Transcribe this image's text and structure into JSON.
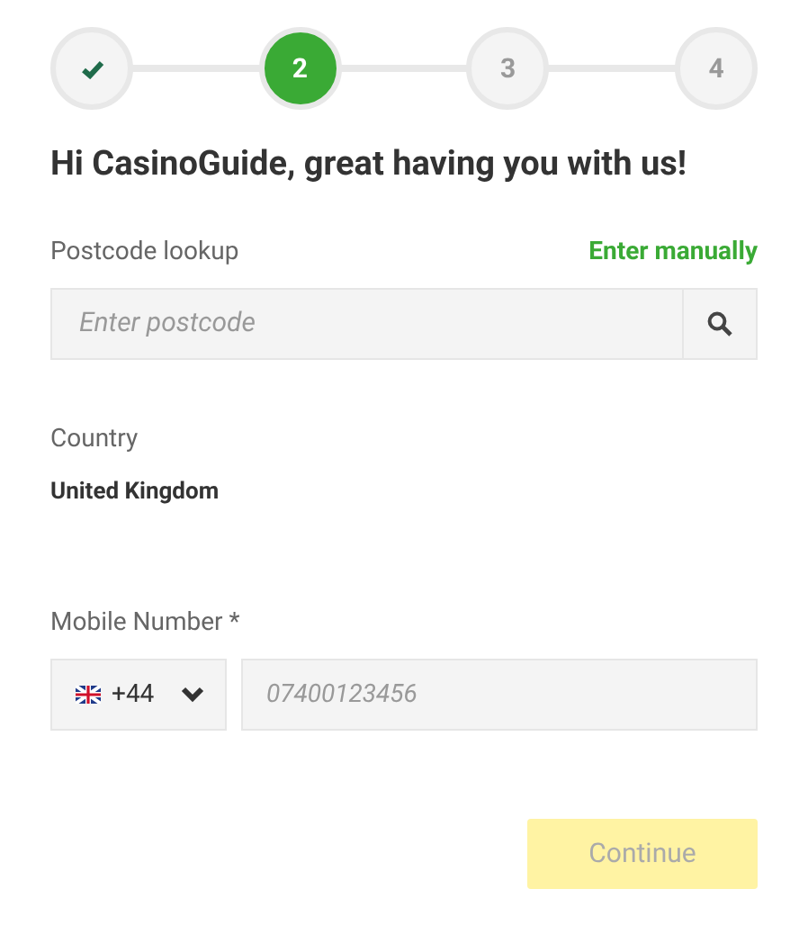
{
  "steps": [
    {
      "kind": "done"
    },
    {
      "kind": "current",
      "label": "2"
    },
    {
      "kind": "upcoming",
      "label": "3"
    },
    {
      "kind": "upcoming",
      "label": "4"
    }
  ],
  "heading": "Hi CasinoGuide, great having you with us!",
  "postcode": {
    "label": "Postcode lookup",
    "link": "Enter manually",
    "placeholder": "Enter postcode"
  },
  "country": {
    "label": "Country",
    "value": "United Kingdom"
  },
  "mobile": {
    "label": "Mobile Number *",
    "dial_code": "+44",
    "placeholder": "07400123456"
  },
  "continue_button": {
    "label": "Continue",
    "disabled": true
  }
}
